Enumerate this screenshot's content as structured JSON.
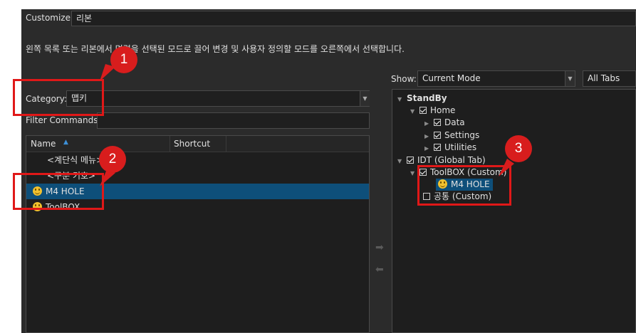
{
  "customize": {
    "label": "Customize:",
    "value": "리본"
  },
  "instruction": "왼쪽 목록 또는 리본에서 명령을 선택된 모드로 끌어 변경 및 사용자 정의할 모드를 오른쪽에서 선택합니다.",
  "left": {
    "category_label": "Category:",
    "category_value": "맵키",
    "filter_label": "Filter Commands:",
    "filter_value": "",
    "columns": {
      "name": "Name",
      "shortcut": "Shortcut"
    },
    "rows": [
      {
        "label": "<계단식 메뉴>",
        "icon": ""
      },
      {
        "label": "<구분 기호>",
        "icon": ""
      },
      {
        "label": "M4 HOLE",
        "icon": "smiley-icon",
        "selected": true
      },
      {
        "label": "ToolBOX",
        "icon": "smiley-icon"
      }
    ]
  },
  "right": {
    "show_label": "Show:",
    "show_value": "Current Mode",
    "tabs_value": "All Tabs",
    "tree": {
      "standby": "StandBy",
      "home": "Home",
      "data": "Data",
      "settings": "Settings",
      "utilities": "Utilities",
      "idt": "IDT (Global Tab)",
      "toolbox": "ToolBOX (Custom)",
      "m4hole": "M4 HOLE",
      "common": "공통 (Custom)"
    }
  },
  "annotations": {
    "n1": "1",
    "n2": "2",
    "n3": "3"
  },
  "colors": {
    "panel": "#2b2b2b",
    "selection": "#0e4f7a",
    "callout": "#e01818"
  }
}
